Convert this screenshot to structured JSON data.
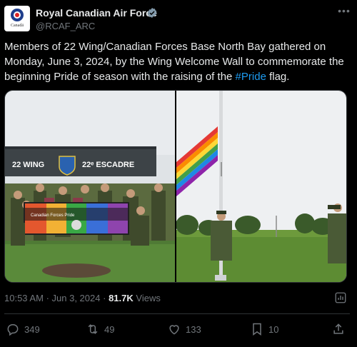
{
  "author": {
    "name": "Royal Canadian Air Force",
    "handle": "@RCAF_ARC",
    "avatar_wordmark": "Canadä"
  },
  "post": {
    "text_before": "Members of 22 Wing/Canadian Forces Base North Bay gathered on Monday, June 3, 2024, by the Wing Welcome Wall to commemorate the beginning Pride of season with the raising of the ",
    "hashtag": "#Pride",
    "text_after": " flag."
  },
  "media": {
    "sign_left": "22 WING",
    "sign_right": "22ᵉ ESCADRE",
    "banner_text": "Canadian Forces Pride"
  },
  "meta": {
    "time": "10:53 AM",
    "separator": "·",
    "date": "Jun 3, 2024",
    "views_count": "81.7K",
    "views_label": "Views"
  },
  "actions": {
    "replies": "349",
    "reposts": "49",
    "likes": "133",
    "bookmarks": "10"
  },
  "colors": {
    "background": "#000000",
    "text": "#e7e9ea",
    "muted": "#71767b",
    "link": "#1d9bf0",
    "verified": "#829aab"
  },
  "icons": [
    "more-icon",
    "verified-icon",
    "analytics-icon",
    "reply-icon",
    "repost-icon",
    "like-icon",
    "bookmark-icon",
    "share-icon"
  ]
}
